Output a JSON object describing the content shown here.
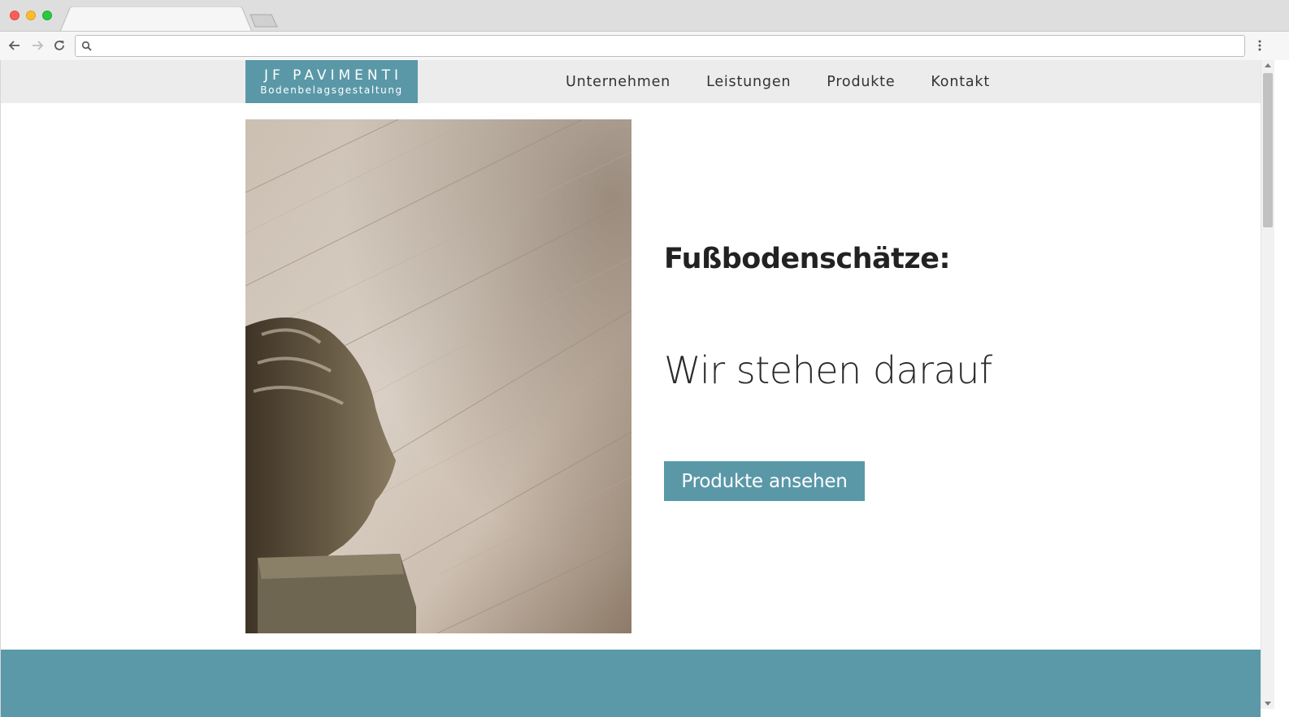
{
  "browser": {
    "address_value": "",
    "icons": [
      "back-arrow-icon",
      "forward-arrow-icon",
      "reload-icon",
      "search-icon",
      "more-menu-icon"
    ]
  },
  "site": {
    "logo": {
      "title": "JF PAVIMENTI",
      "subtitle": "Bodenbelagsgestaltung"
    },
    "nav": [
      {
        "label": "Unternehmen"
      },
      {
        "label": "Leistungen"
      },
      {
        "label": "Produkte"
      },
      {
        "label": "Kontakt"
      }
    ],
    "hero": {
      "headline": "Fußbodenschätze:",
      "tagline": "Wir stehen darauf",
      "cta_label": "Produkte ansehen"
    }
  },
  "colors": {
    "accent": "#5a98a8",
    "header_bg": "#ececec",
    "text": "#222222"
  }
}
